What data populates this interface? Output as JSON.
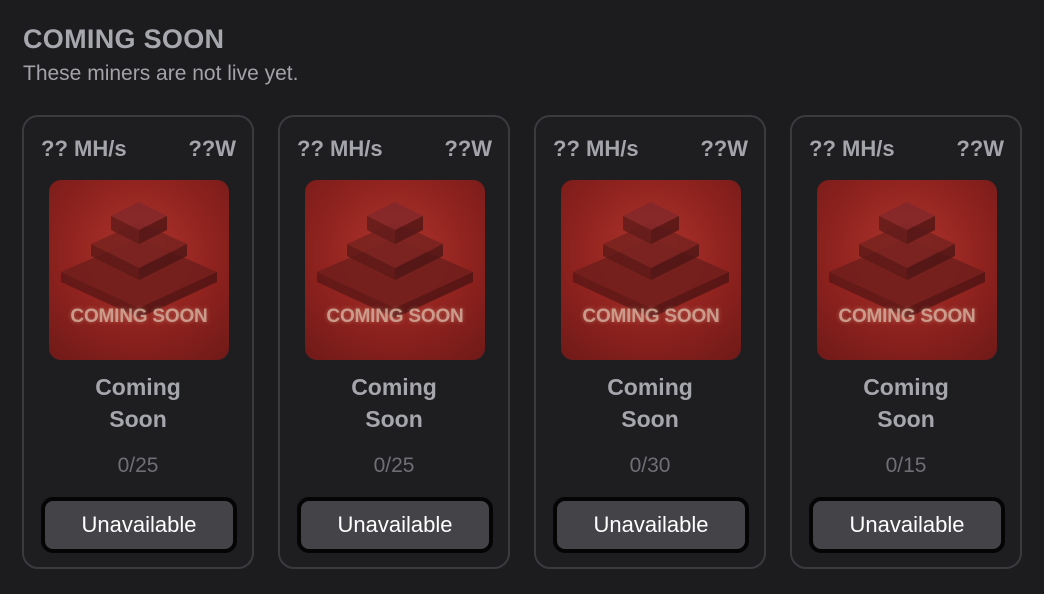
{
  "section": {
    "title": "COMING SOON",
    "subtitle": "These miners are not live yet."
  },
  "colors": {
    "background": "#1c1c1e",
    "card_border": "#3a3a3f",
    "thumbnail_red": "#9b2822",
    "button_bg": "#434348"
  },
  "cards": [
    {
      "hashrate": "?? MH/s",
      "power": "??W",
      "image_label": "COMING SOON",
      "name_line1": "Coming",
      "name_line2": "Soon",
      "count": "0/25",
      "button_label": "Unavailable"
    },
    {
      "hashrate": "?? MH/s",
      "power": "??W",
      "image_label": "COMING SOON",
      "name_line1": "Coming",
      "name_line2": "Soon",
      "count": "0/25",
      "button_label": "Unavailable"
    },
    {
      "hashrate": "?? MH/s",
      "power": "??W",
      "image_label": "COMING SOON",
      "name_line1": "Coming",
      "name_line2": "Soon",
      "count": "0/30",
      "button_label": "Unavailable"
    },
    {
      "hashrate": "?? MH/s",
      "power": "??W",
      "image_label": "COMING SOON",
      "name_line1": "Coming",
      "name_line2": "Soon",
      "count": "0/15",
      "button_label": "Unavailable"
    }
  ]
}
